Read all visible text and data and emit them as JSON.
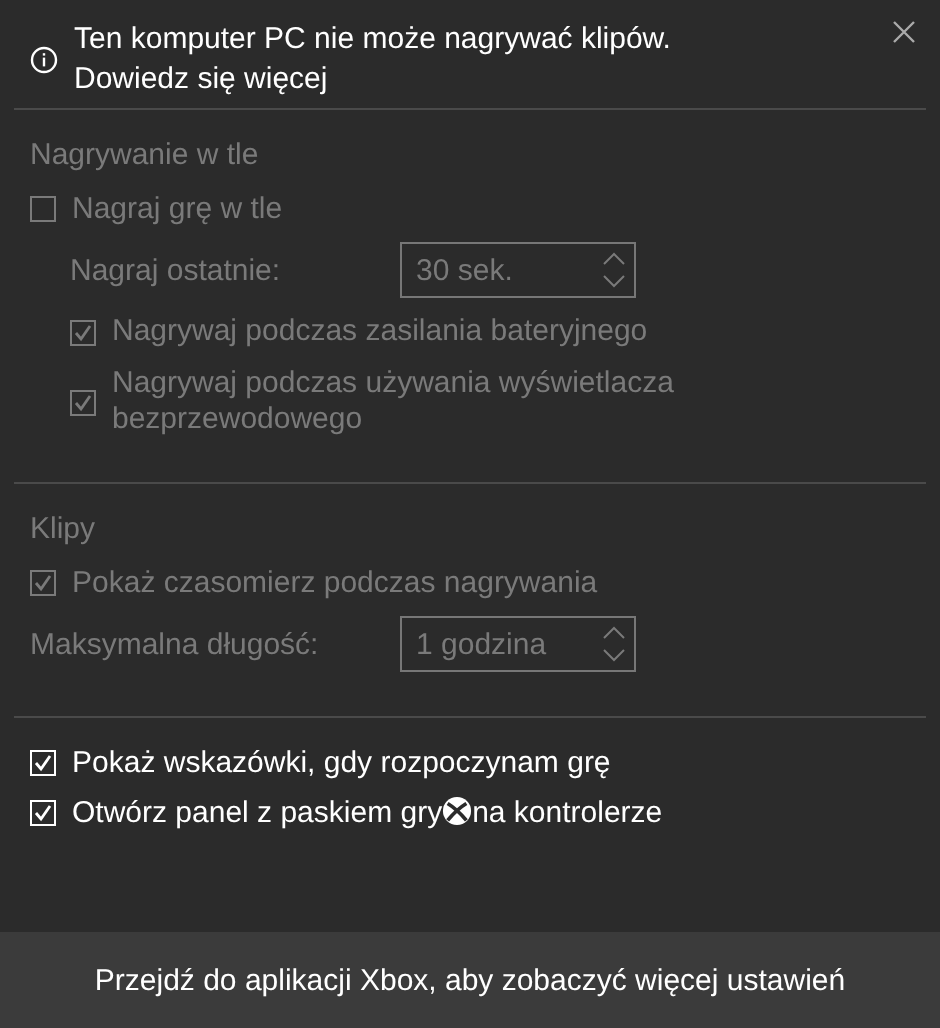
{
  "notice": {
    "text": "Ten komputer PC nie może nagrywać klipów.",
    "link": "Dowiedz się więcej"
  },
  "sections": [
    {
      "title": "Nagrywanie w tle",
      "disabled": true,
      "items": [
        {
          "kind": "checkbox",
          "label": "Nagraj grę w tle",
          "checked": false,
          "children": [
            {
              "kind": "spinner",
              "label": "Nagraj ostatnie:",
              "value": "30 sek."
            },
            {
              "kind": "checkbox",
              "label": "Nagrywaj podczas zasilania bateryjnego",
              "checked": true
            },
            {
              "kind": "checkbox",
              "label": "Nagrywaj podczas używania wyświetlacza bezprzewodowego",
              "checked": true
            }
          ]
        }
      ]
    },
    {
      "title": "Klipy",
      "disabled": true,
      "items": [
        {
          "kind": "checkbox",
          "label": "Pokaż czasomierz podczas nagrywania",
          "checked": true
        },
        {
          "kind": "spinner",
          "label": "Maksymalna długość:",
          "value": "1 godzina"
        }
      ]
    },
    {
      "disabled": false,
      "items": [
        {
          "kind": "checkbox",
          "label": "Pokaż wskazówki, gdy rozpoczynam grę",
          "checked": true
        },
        {
          "kind": "checkbox",
          "label": "Otwórz panel z paskiem gry",
          "label_after": "na kontrolerze",
          "checked": true
        }
      ]
    }
  ],
  "footer": "Przejdź do aplikacji Xbox, aby zobaczyć więcej ustawień"
}
